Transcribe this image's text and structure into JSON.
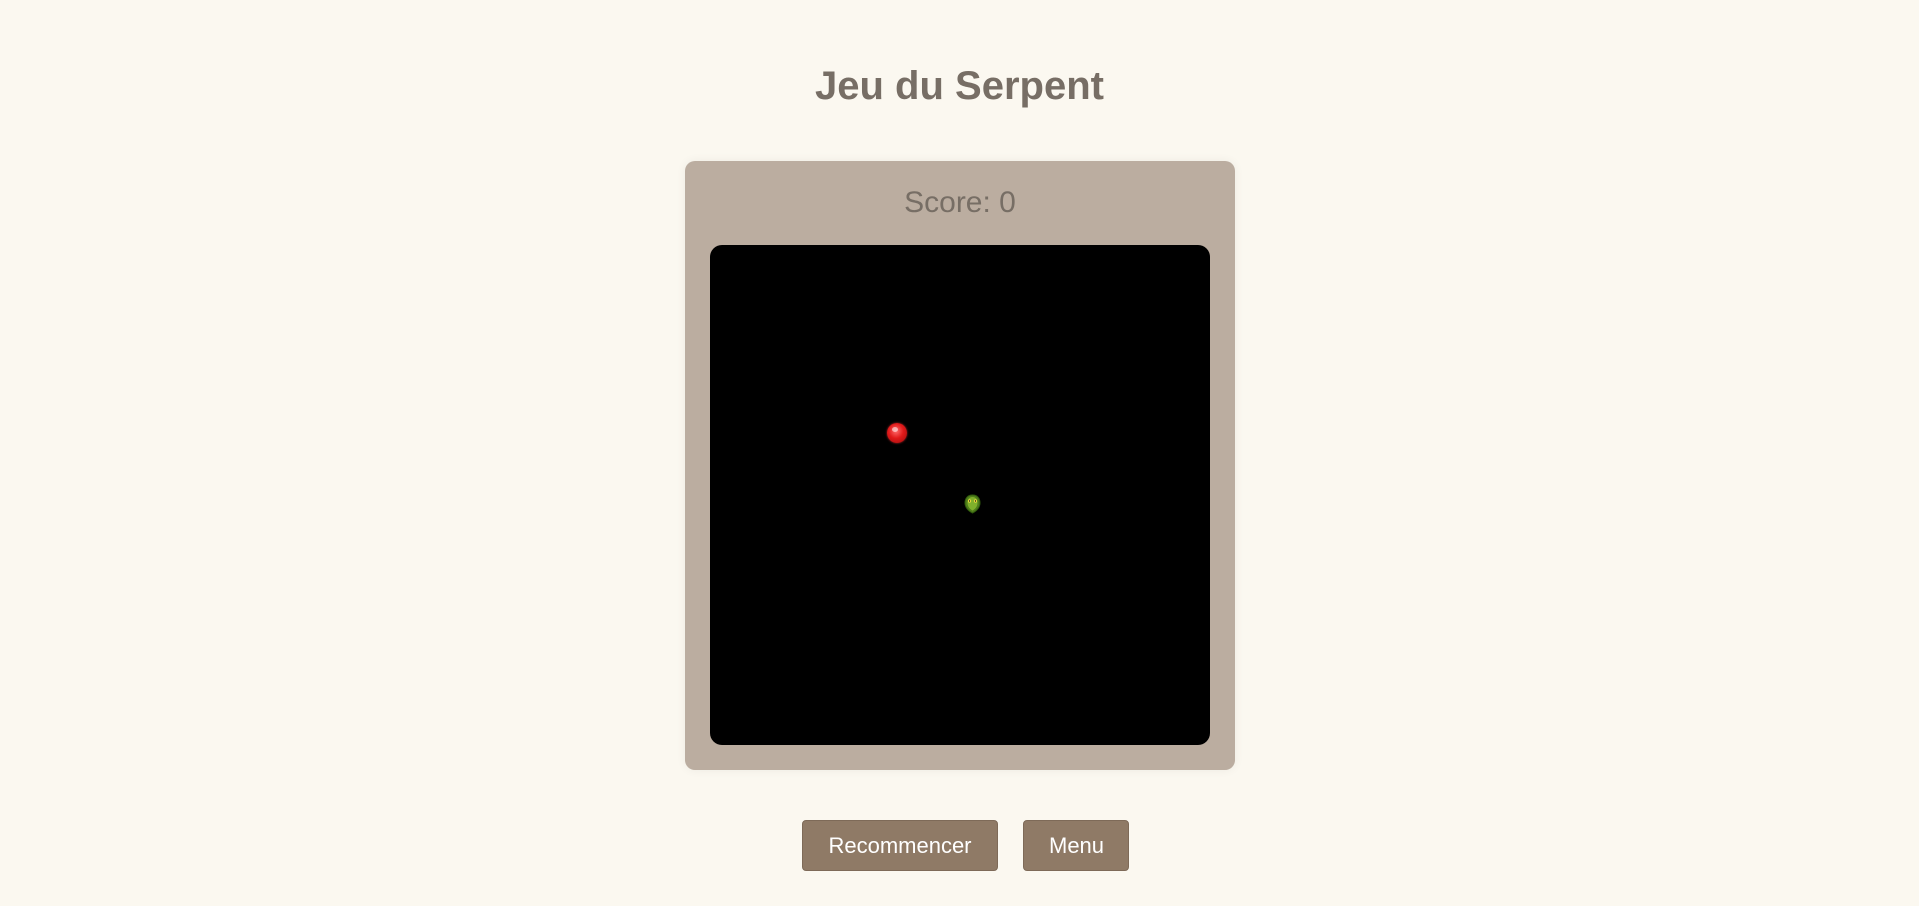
{
  "header": {
    "title": "Jeu du Serpent"
  },
  "scoreboard": {
    "score_text": "Score: 0",
    "score_value": 0
  },
  "board": {
    "background": "#000000",
    "food_icon": "apple-icon",
    "food_color": "#e01a1a",
    "snake_head_icon": "snake-head-icon",
    "snake_color": "#5a8a1e"
  },
  "controls": {
    "restart_label": "Recommencer",
    "menu_label": "Menu"
  },
  "colors": {
    "page_background": "#fbf8f0",
    "panel_background": "#bbada0",
    "text_color": "#776e65",
    "button_background": "#8f7a66",
    "button_text": "#ffffff"
  }
}
